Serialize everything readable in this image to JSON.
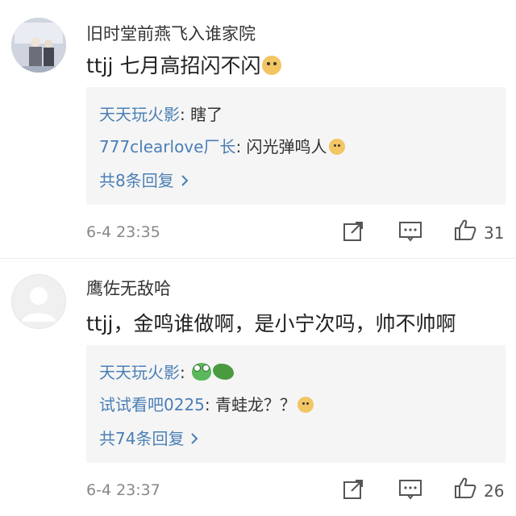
{
  "comments": [
    {
      "username": "旧时堂前燕飞入谁家院",
      "text": "ttjj 七月高招闪不闪",
      "text_emoji": "doge-icon",
      "replies": [
        {
          "author": "天天玩火影",
          "sep": ":",
          "text": " 瞎了",
          "emoji": ""
        },
        {
          "author": "777clearlove厂长",
          "sep": ":",
          "text": " 闪光弹鸣人",
          "emoji": "doge-icon"
        }
      ],
      "more_replies": "共8条回复",
      "timestamp": "6-4 23:35",
      "likes": "31"
    },
    {
      "username": "鹰佐无敌哈",
      "text": "ttjj，金鸣谁做啊，是小宁次吗，帅不帅啊",
      "text_emoji": "",
      "replies": [
        {
          "author": "天天玩火影",
          "sep": ":",
          "text": " ",
          "emoji": "frog-dragon-icons"
        },
        {
          "author": "试试看吧0225",
          "sep": ":",
          "text": " 青蛙龙？？",
          "emoji": "doge-icon"
        }
      ],
      "more_replies": "共74条回复",
      "timestamp": "6-4 23:37",
      "likes": "26"
    }
  ],
  "colors": {
    "reply_author": "#4a7fb5",
    "reply_bg": "#f5f5f5",
    "timestamp": "#888888"
  }
}
